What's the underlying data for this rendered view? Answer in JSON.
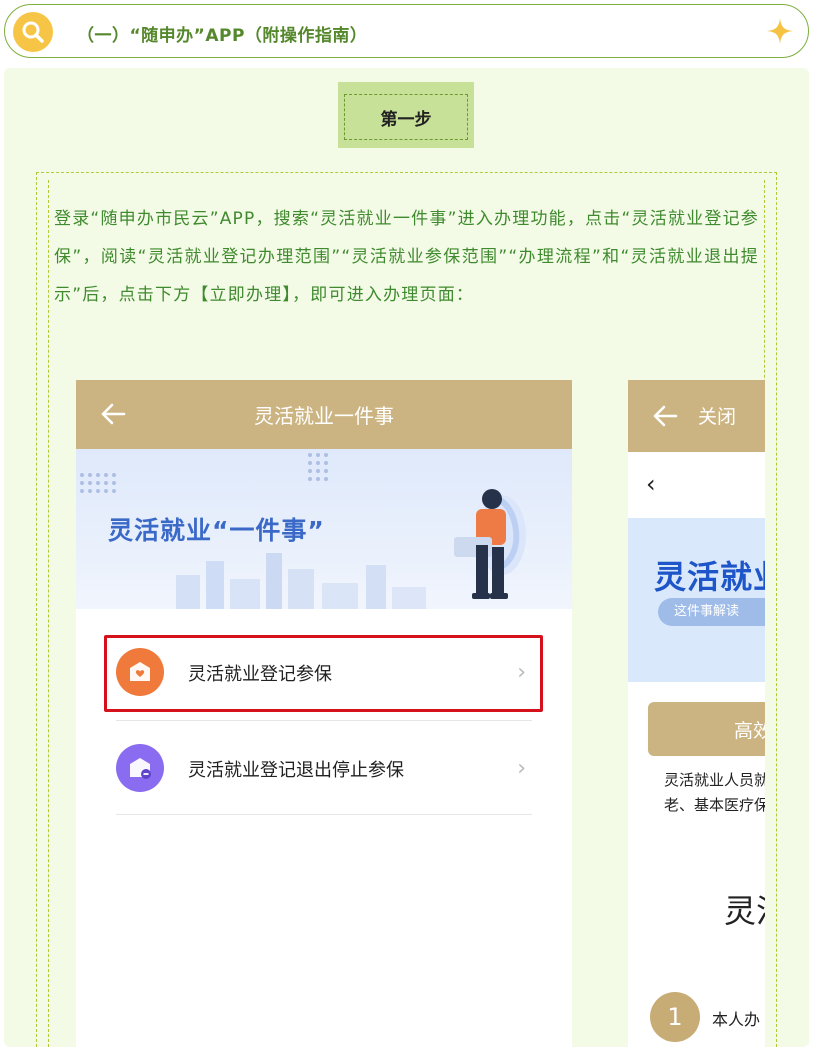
{
  "header": {
    "title": "（一）“随申办”APP（附操作指南）",
    "search_icon": "search-icon",
    "sparkle_icon": "sparkle-icon",
    "accent_color": "#55882c"
  },
  "step": {
    "label": "第一步"
  },
  "instruction": "登录“随申办市民云”APP，搜索“灵活就业一件事”进入办理功能，点击“灵活就业登记参保”，阅读“灵活就业登记办理范围”“灵活就业参保范围”“办理流程”和“灵活就业退出提示”后，点击下方【立即办理】，即可进入办理页面：",
  "phone1": {
    "title": "灵活就业一件事",
    "back_icon": "arrow-left-icon",
    "banner_title": "灵活就业“一件事”",
    "items": [
      {
        "label": "灵活就业登记参保",
        "icon": "shield-heart-icon",
        "color": "#f07a3c"
      },
      {
        "label": "灵活就业登记退出停止参保",
        "icon": "shield-minus-icon",
        "color": "#8a6cf0"
      }
    ]
  },
  "phone2": {
    "close_label": "关闭",
    "back_icon": "arrow-left-icon",
    "page_back": "‹",
    "banner_title": "灵活就业",
    "banner_pill": "这件事解读",
    "card_label": "高效办",
    "desc_line1": "灵活就业人员就",
    "desc_line2": "老、基本医疗保",
    "big_text": "灵活",
    "step_number": "1",
    "step_text": "本人办"
  }
}
